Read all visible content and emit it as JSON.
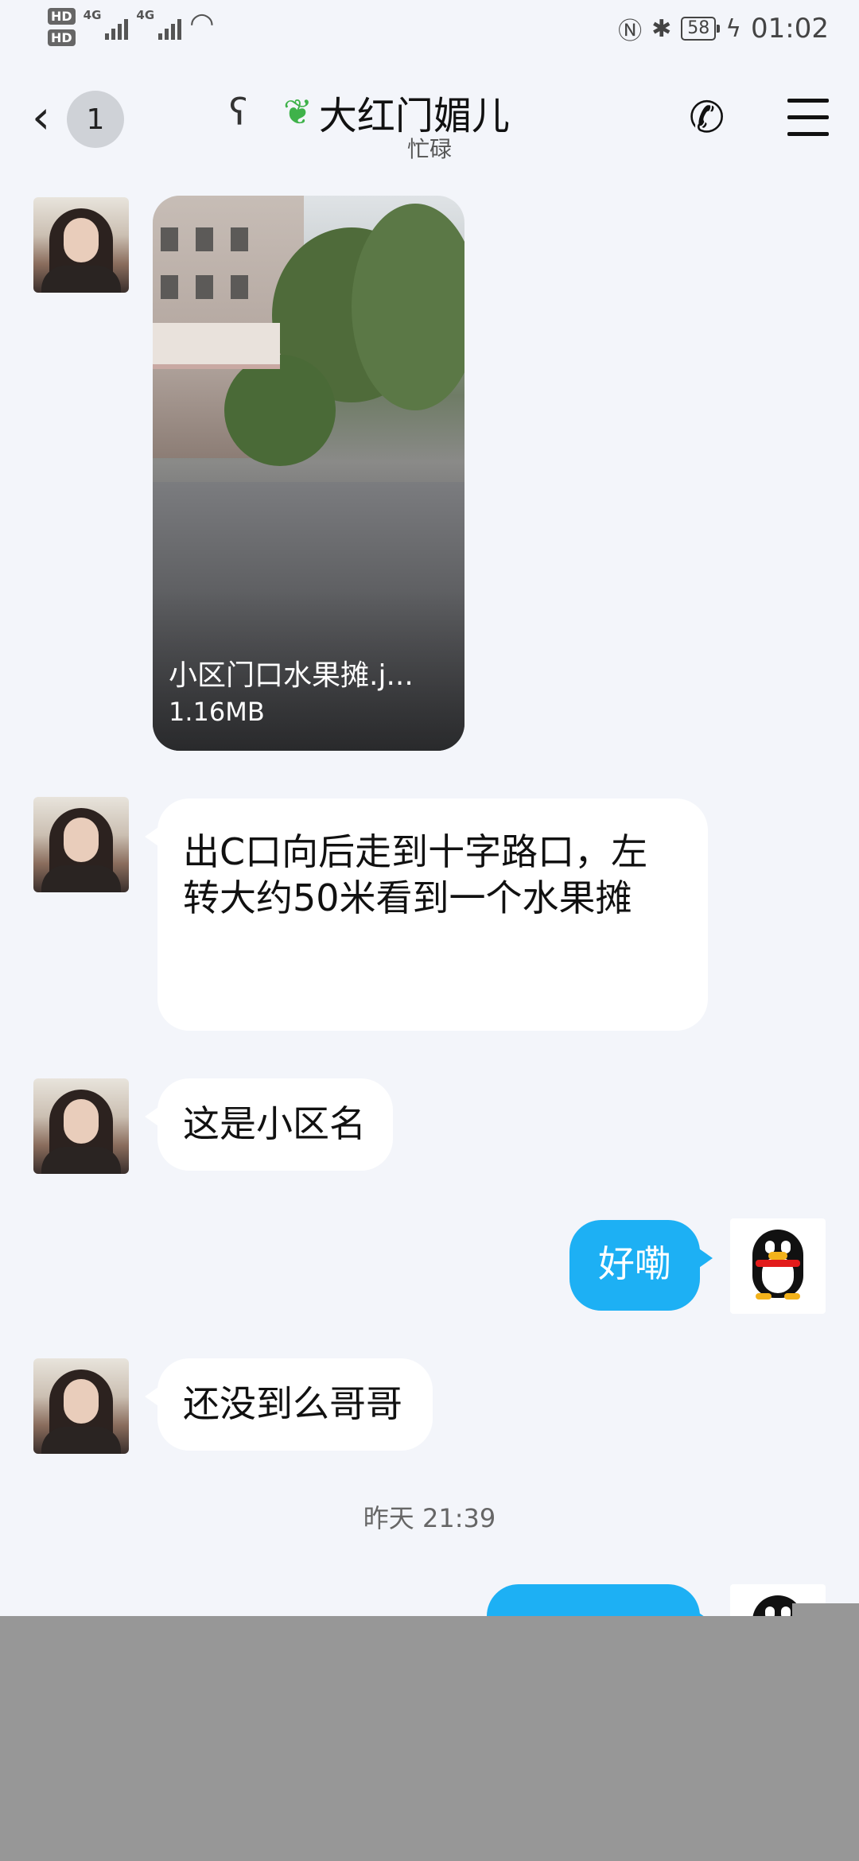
{
  "status_bar": {
    "hd1": "HD",
    "hd2": "HD",
    "net1": "4G",
    "net2": "4G",
    "battery": "58",
    "time": "01:02"
  },
  "header": {
    "back_count": "1",
    "title": "大红门媚儿",
    "subtitle": "忙碌"
  },
  "messages": {
    "file_name": "小区门口水果摊.j...",
    "file_size": "1.16MB",
    "m1": "出C口向后走到十字路口，左转大约50米看到一个水果摊",
    "m2": "这是小区名",
    "m3": "好嘞",
    "m4": "还没到么哥哥"
  },
  "timestamp": "昨天 21:39",
  "colors": {
    "background": "#f3f5fa",
    "my_bubble": "#1db0f4",
    "her_bubble": "#ffffff",
    "overlay": "#979797"
  },
  "icons": [
    "signal-icon",
    "wifi-icon",
    "nfc-icon",
    "bluetooth-icon",
    "battery-icon",
    "back-icon",
    "ear-icon",
    "sprout-icon",
    "phone-icon",
    "menu-icon",
    "penguin-avatar-icon"
  ]
}
